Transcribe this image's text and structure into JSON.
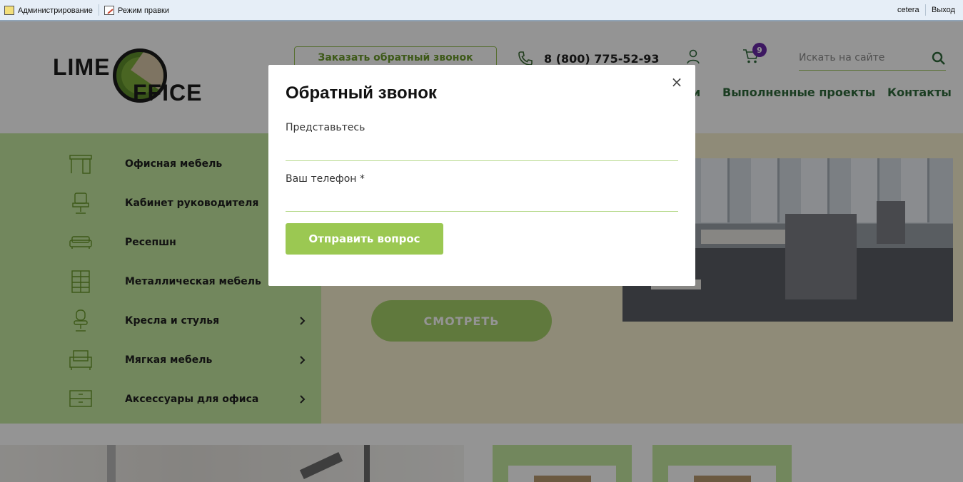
{
  "adminbar": {
    "admin_label": "Администрирование",
    "edit_mode_label": "Режим правки",
    "user_label": "cetera",
    "logout_label": "Выход"
  },
  "header": {
    "logo_word_1": "LIME",
    "logo_word_2": "FFICE",
    "callback_label": "Заказать обратный звонок",
    "phone": "8 (800) 775-52-93",
    "cart_count": "9",
    "search_placeholder": "Искать на сайте",
    "nav": [
      {
        "label": "и"
      },
      {
        "label": "Выполненные проекты"
      },
      {
        "label": "Контакты"
      }
    ]
  },
  "catalog": {
    "items": [
      {
        "label": "Офисная мебель",
        "icon": "office-furniture-icon"
      },
      {
        "label": "Кабинет руководителя",
        "icon": "executive-chair-icon"
      },
      {
        "label": "Ресепшн",
        "icon": "sofa-icon"
      },
      {
        "label": "Металлическая мебель",
        "icon": "cabinet-icon"
      },
      {
        "label": "Кресла и стулья",
        "icon": "office-chair-icon"
      },
      {
        "label": "Мягкая мебель",
        "icon": "armchair-icon"
      },
      {
        "label": "Аксессуары для офиса",
        "icon": "drawer-icon"
      }
    ]
  },
  "hero": {
    "watch_label": "СМОТРЕТЬ"
  },
  "modal": {
    "title": "Обратный звонок",
    "name_label": "Представьтесь",
    "phone_label": "Ваш телефон *",
    "submit_label": "Отправить вопрос",
    "close_glyph": "×"
  },
  "colors": {
    "accent_green": "#9bc852",
    "nav_green": "#2f6a3c",
    "catalog_bg": "#c4e8a0",
    "hero_bg": "#f6efcf",
    "badge_purple": "#6a2aa8"
  }
}
